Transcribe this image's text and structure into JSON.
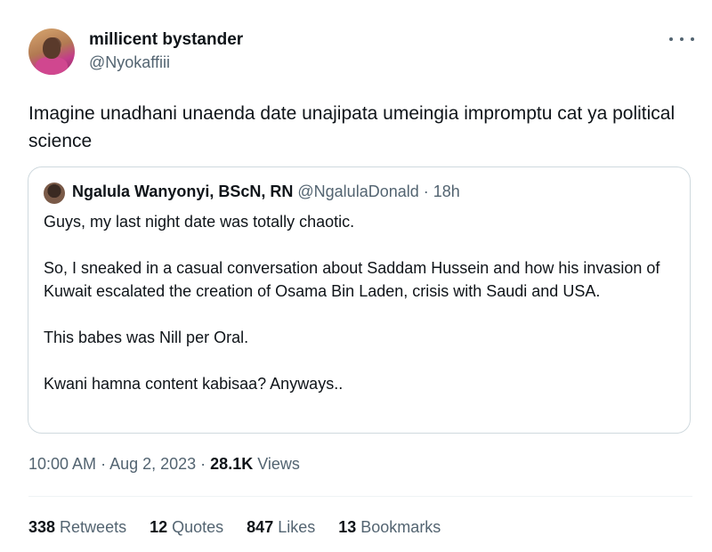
{
  "author": {
    "display_name": "millicent bystander",
    "handle": "@Nyokaffiii"
  },
  "tweet": {
    "text": "Imagine unadhani unaenda date unajipata umeingia impromptu cat ya political science"
  },
  "quoted_tweet": {
    "author_name": "Ngalula Wanyonyi, BScN, RN",
    "author_handle": "@NgalulaDonald",
    "separator": " · ",
    "time_ago": "18h",
    "paragraphs": [
      "Guys, my last night date was totally chaotic.",
      "So, I sneaked in a casual conversation about Saddam Hussein and how his invasion of Kuwait escalated the creation of Osama Bin Laden, crisis with Saudi and USA.",
      "This babes was Nill per Oral.",
      "Kwani hamna content kabisaa? Anyways.."
    ]
  },
  "meta": {
    "time": "10:00 AM",
    "separator": " · ",
    "date": "Aug 2, 2023",
    "views_count": "28.1K",
    "views_label": " Views"
  },
  "stats": [
    {
      "count": "338",
      "label": " Retweets"
    },
    {
      "count": "12",
      "label": " Quotes"
    },
    {
      "count": "847",
      "label": " Likes"
    },
    {
      "count": "13",
      "label": " Bookmarks"
    }
  ],
  "icons": {
    "more": "more-horizontal-icon"
  },
  "colors": {
    "text_primary": "#0f1419",
    "text_secondary": "#536471",
    "border": "#cfd9de"
  }
}
